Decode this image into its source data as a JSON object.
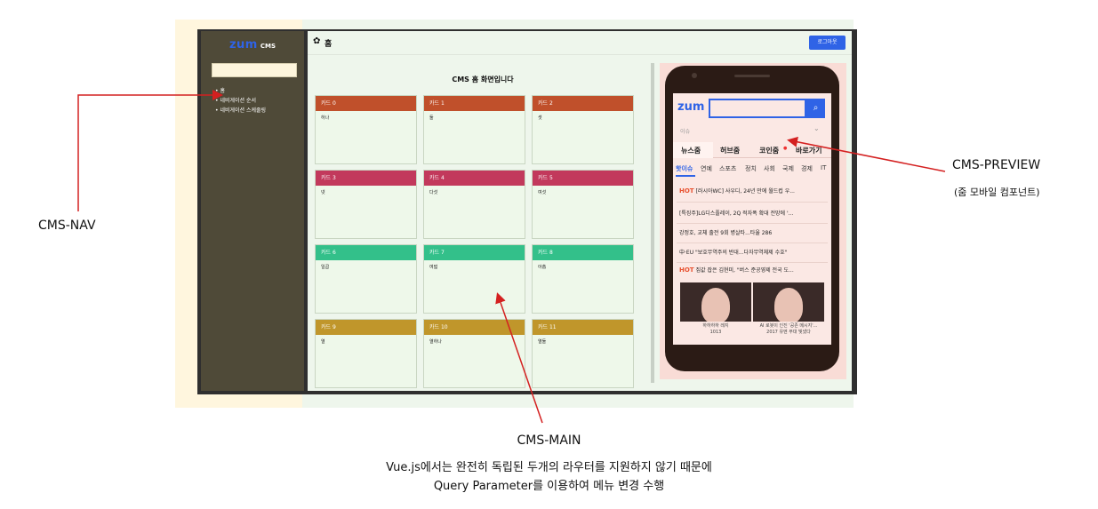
{
  "nav": {
    "logo": "zum",
    "logo_suffix": "CMS",
    "items": [
      {
        "label": "홈"
      },
      {
        "label": "네비게이션 순서"
      },
      {
        "label": "네비게이션 스케줄링"
      }
    ]
  },
  "header": {
    "gear_icon": "gear-icon",
    "title": "홈",
    "logout_label": "로그아웃"
  },
  "main": {
    "title": "CMS 홈 화면입니다",
    "cards": [
      {
        "title": "카드 0",
        "body": "하나",
        "color": "#c0502b"
      },
      {
        "title": "카드 1",
        "body": "둘",
        "color": "#c0502b"
      },
      {
        "title": "카드 2",
        "body": "셋",
        "color": "#c0502b"
      },
      {
        "title": "카드 3",
        "body": "넷",
        "color": "#c2395c"
      },
      {
        "title": "카드 4",
        "body": "다섯",
        "color": "#c2395c"
      },
      {
        "title": "카드 5",
        "body": "여섯",
        "color": "#c2395c"
      },
      {
        "title": "카드 6",
        "body": "일곱",
        "color": "#33c08a"
      },
      {
        "title": "카드 7",
        "body": "여덟",
        "color": "#33c08a"
      },
      {
        "title": "카드 8",
        "body": "아홉",
        "color": "#33c08a"
      },
      {
        "title": "카드 9",
        "body": "열",
        "color": "#c0962b"
      },
      {
        "title": "카드 10",
        "body": "열하나",
        "color": "#c0962b"
      },
      {
        "title": "카드 11",
        "body": "열둘",
        "color": "#c0962b"
      }
    ]
  },
  "preview": {
    "logo": "zum",
    "search_icon": "search-icon",
    "issue_label": "이슈",
    "tabs": [
      "뉴스줌",
      "허브줌",
      "코인줌",
      "바로가기"
    ],
    "categories": [
      "핫이슈",
      "연예",
      "스포츠",
      "정치",
      "사회",
      "국제",
      "경제",
      "IT"
    ],
    "news": [
      {
        "hot": "HOT",
        "text": "[러시아WC] 사우디, 24년 만에 월드컵 우..."
      },
      {
        "hot": "",
        "text": "[특징주]LG디스플레이, 2Q 적자폭 확대 전망에 '..."
      },
      {
        "hot": "",
        "text": "강정호, 교체 출전 9회 병살타...타율 286"
      },
      {
        "hot": "",
        "text": "中·EU \"보호무역주의 반대...다자무역체제 수호\""
      },
      {
        "hot": "HOT",
        "text": "집값 잡은 김현미, \"버스 준공영제 전국 도..."
      }
    ],
    "images": [
      {
        "caption_1": "하하하하 레지",
        "caption_2": "1013"
      },
      {
        "caption_1": "AI 로봇이 인진 '공존 메시지'...",
        "caption_2": "2017 유엔 무대 빛냈다"
      }
    ]
  },
  "annotations": {
    "nav": "CMS-NAV",
    "preview": "CMS-PREVIEW",
    "preview_sub": "(줌 모바일 컴포넌트)",
    "main": "CMS-MAIN",
    "main_desc_1": "Vue.js에서는 완전히 독립된 두개의 라우터를 지원하지 않기 때문에",
    "main_desc_2": "Query Parameter를 이용하여 메뉴 변경 수행",
    "arrow_color": "#d42020"
  }
}
